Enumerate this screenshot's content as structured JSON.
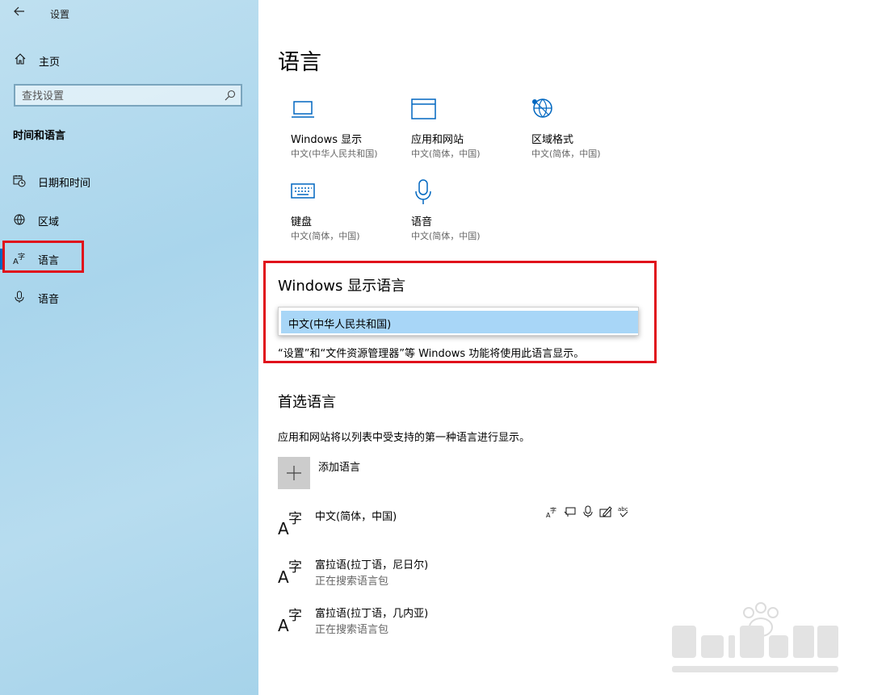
{
  "window": {
    "title": "设置"
  },
  "sidebar": {
    "home_label": "主页",
    "search_placeholder": "查找设置",
    "section_title": "时间和语言",
    "items": [
      {
        "label": "日期和时间",
        "icon": "calendar-clock-icon",
        "active": false
      },
      {
        "label": "区域",
        "icon": "globe-icon",
        "active": false
      },
      {
        "label": "语言",
        "icon": "language-icon",
        "active": true
      },
      {
        "label": "语音",
        "icon": "microphone-icon",
        "active": false
      }
    ]
  },
  "main": {
    "title": "语言",
    "tiles": [
      {
        "name": "Windows 显示",
        "sub": "中文(中华人民共和国)",
        "icon": "laptop-icon"
      },
      {
        "name": "应用和网站",
        "sub": "中文(简体，中国)",
        "icon": "window-icon"
      },
      {
        "name": "区域格式",
        "sub": "中文(简体，中国)",
        "icon": "globe-icon"
      },
      {
        "name": "键盘",
        "sub": "中文(简体，中国)",
        "icon": "keyboard-icon"
      },
      {
        "name": "语音",
        "sub": "中文(简体，中国)",
        "icon": "microphone-icon"
      }
    ],
    "display_language": {
      "title": "Windows 显示语言",
      "selected": "中文(中华人民共和国)",
      "description": "“设置”和“文件资源管理器”等 Windows 功能将使用此语言显示。"
    },
    "preferred": {
      "title": "首选语言",
      "description": "应用和网站将以列表中受支持的第一种语言进行显示。",
      "add_label": "添加语言",
      "languages": [
        {
          "name": "中文(简体，中国)",
          "status": ""
        },
        {
          "name": "富拉语(拉丁语，尼日尔)",
          "status": "正在搜索语言包"
        },
        {
          "name": "富拉语(拉丁语，几内亚)",
          "status": "正在搜索语言包"
        }
      ],
      "feature_icons": [
        "display-language-icon",
        "text-to-speech-icon",
        "speech-recognition-icon",
        "handwriting-icon",
        "spellcheck-icon"
      ]
    },
    "accent_color": "#0067c0",
    "highlight_color": "#e0111b"
  }
}
